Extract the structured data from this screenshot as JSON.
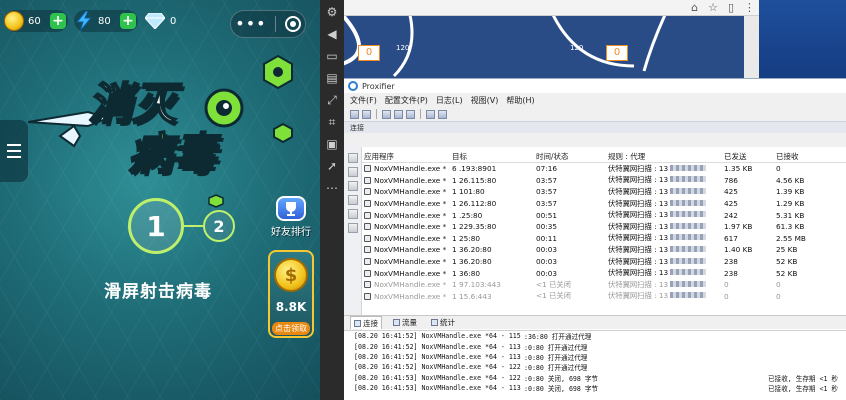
{
  "game": {
    "coins": "60",
    "energy": "80",
    "diamonds": "0",
    "plus": "+",
    "capsule_dots": "•••",
    "title_line1": "消灭",
    "title_line2": "病毒",
    "level_current": "1",
    "level_next": "2",
    "slide_hint": "滑屏射击病毒",
    "friend_rank_label": "好友排行",
    "reward_amount": "8.8K",
    "reward_claim_label": "点击领取",
    "reward_coin_symbol": "$",
    "colors": {
      "accent_green": "#7fe03a",
      "coin": "#f2c21a",
      "plus_btn": "#2fc24c"
    }
  },
  "emulator_toolbar": {
    "icons": [
      "settings-icon",
      "speaker-icon",
      "screen-icon",
      "keyboard-icon",
      "fullscreen-icon",
      "keymap-icon",
      "record-icon",
      "rocket-icon",
      "more-icon"
    ]
  },
  "browser": {
    "gauges": [
      {
        "value": "0",
        "max_label": "120"
      },
      {
        "value": "0",
        "max_label": "120"
      }
    ]
  },
  "proxifier": {
    "title": "Proxifier",
    "menu": [
      "文件(F)",
      "配置文件(P)",
      "日志(L)",
      "视图(V)",
      "帮助(H)"
    ],
    "section_label": "连接",
    "columns": [
      "应用程序",
      "目标",
      "时间/状态",
      "规则 : 代理",
      "已发送",
      "已接收"
    ],
    "connections": [
      {
        "app": "NoxVMHandle.exe *",
        "target": "6      .193:8901",
        "time": "07:16",
        "rule": "伏特翼网扫描 : 13",
        "sent": "1.35 KB",
        "recv": "0",
        "dim": false
      },
      {
        "app": "NoxVMHandle.exe *",
        "target": "1      26.115:80",
        "time": "03:57",
        "rule": "伏特翼网扫描 : 13",
        "sent": "786",
        "recv": "4.56 KB",
        "dim": false
      },
      {
        "app": "NoxVMHandle.exe *",
        "target": "1      101:80",
        "time": "03:57",
        "rule": "伏特翼网扫描 : 13",
        "sent": "425",
        "recv": "1.39 KB",
        "dim": false
      },
      {
        "app": "NoxVMHandle.exe *",
        "target": "1      26.112:80",
        "time": "03:57",
        "rule": "伏特翼网扫描 : 13",
        "sent": "425",
        "recv": "1.29 KB",
        "dim": false
      },
      {
        "app": "NoxVMHandle.exe *",
        "target": "1      .25:80",
        "time": "00:51",
        "rule": "伏特翼网扫描 : 13",
        "sent": "242",
        "recv": "5.31 KB",
        "dim": false
      },
      {
        "app": "NoxVMHandle.exe *",
        "target": "1      229.35:80",
        "time": "00:35",
        "rule": "伏特翼网扫描 : 13",
        "sent": "1.97 KB",
        "recv": "61.3 KB",
        "dim": false
      },
      {
        "app": "NoxVMHandle.exe *",
        "target": "1      25:80",
        "time": "00:11",
        "rule": "伏特翼网扫描 : 13",
        "sent": "617",
        "recv": "2.55 MB",
        "dim": false
      },
      {
        "app": "NoxVMHandle.exe *",
        "target": "1      36.20:80",
        "time": "00:03",
        "rule": "伏特翼网扫描 : 13",
        "sent": "1.40 KB",
        "recv": "25 KB",
        "dim": false
      },
      {
        "app": "NoxVMHandle.exe *",
        "target": "1      36.20:80",
        "time": "00:03",
        "rule": "伏特翼网扫描 : 13",
        "sent": "238",
        "recv": "52 KB",
        "dim": false
      },
      {
        "app": "NoxVMHandle.exe *",
        "target": "1      36:80",
        "time": "00:03",
        "rule": "伏特翼网扫描 : 13",
        "sent": "238",
        "recv": "52 KB",
        "dim": false
      },
      {
        "app": "NoxVMHandle.exe *",
        "target": "1      97.103:443",
        "time": "<1 已关闭",
        "rule": "伏特翼网扫描 : 13",
        "sent": "0",
        "recv": "0",
        "dim": true
      },
      {
        "app": "NoxVMHandle.exe *",
        "target": "1      15.6:443",
        "time": "<1 已关闭",
        "rule": "伏特翼网扫描 : 13",
        "sent": "0",
        "recv": "0",
        "dim": true
      }
    ],
    "tabs": [
      "连接",
      "流量",
      "统计"
    ],
    "log": [
      {
        "left": "[08.20 16:41:52] NoxVMHandle.exe *64 - 115",
        "mid": ":36:80 打开通过代理",
        "right": ""
      },
      {
        "left": "[08.20 16:41:52] NoxVMHandle.exe *64 - 113",
        "mid": ":0:80 打开通过代理",
        "right": ""
      },
      {
        "left": "[08.20 16:41:52] NoxVMHandle.exe *64 - 113",
        "mid": ":0:80 打开通过代理",
        "right": ""
      },
      {
        "left": "[08.20 16:41:52] NoxVMHandle.exe *64 - 122",
        "mid": ":0:80 打开通过代理",
        "right": ""
      },
      {
        "left": "[08.20 16:41:53] NoxVMHandle.exe *64 - 122",
        "mid": ":0:80 关闭, 698 字节",
        "right": "已接收, 生存期 <1 秒"
      },
      {
        "left": "[08.20 16:41:53] NoxVMHandle.exe *64 - 113",
        "mid": ":0:80 关闭, 698 字节",
        "right": "已接收, 生存期 <1 秒"
      }
    ]
  }
}
